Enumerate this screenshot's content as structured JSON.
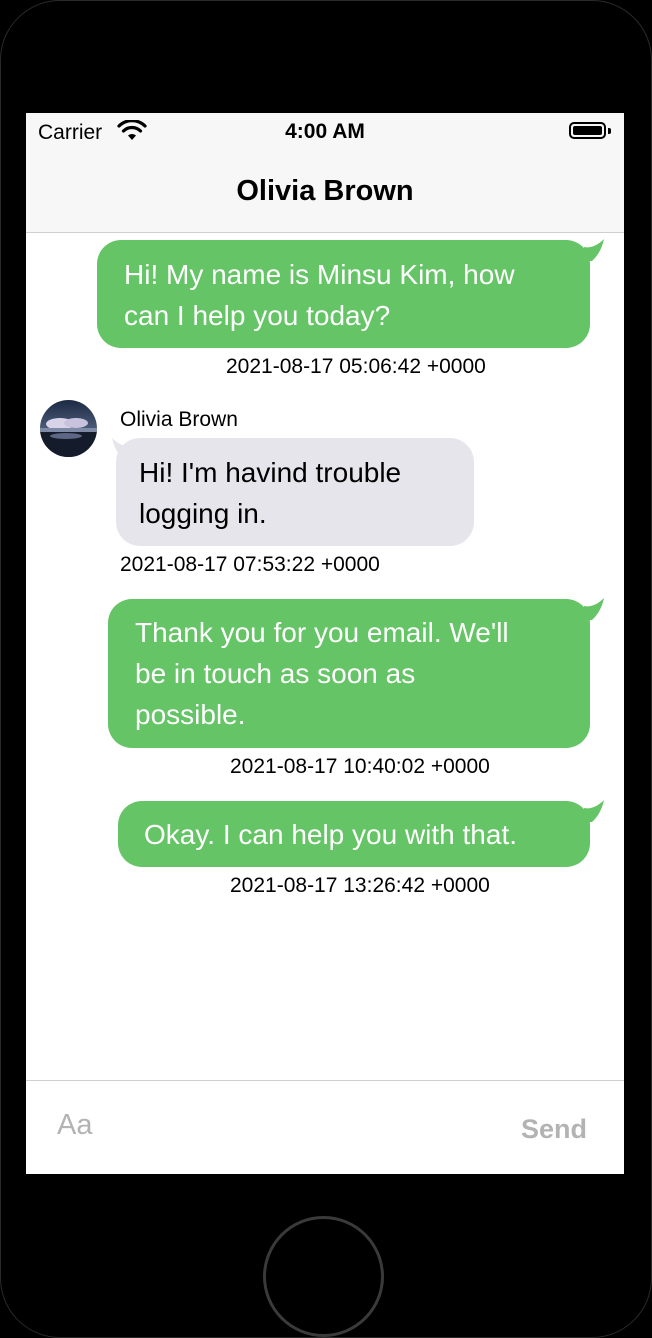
{
  "status_bar": {
    "carrier": "Carrier",
    "time": "4:00 AM",
    "wifi_icon": "wifi-icon",
    "battery_icon": "battery-icon"
  },
  "nav": {
    "title": "Olivia Brown"
  },
  "messages": [
    {
      "direction": "outgoing",
      "lines": [
        "Hi! My name is Minsu Kim, how",
        "can I help you today?"
      ],
      "timestamp": "2021-08-17 05:06:42 +0000"
    },
    {
      "direction": "incoming",
      "sender": "Olivia Brown",
      "avatar_icon": "avatar-icon",
      "lines": [
        "Hi! I'm havind trouble",
        "logging in."
      ],
      "timestamp": "2021-08-17 07:53:22 +0000"
    },
    {
      "direction": "outgoing",
      "lines": [
        "Thank you for you email. We'll",
        "be in touch as soon as",
        "possible."
      ],
      "timestamp": "2021-08-17 10:40:02 +0000"
    },
    {
      "direction": "outgoing",
      "lines": [
        "Okay. I can help you with that."
      ],
      "timestamp": "2021-08-17 13:26:42 +0000"
    }
  ],
  "input": {
    "placeholder": "Aa",
    "send_label": "Send"
  },
  "colors": {
    "outgoing_bubble": "#65c466",
    "incoming_bubble": "#e6e5eb",
    "placeholder_text": "#b3b3b3"
  }
}
